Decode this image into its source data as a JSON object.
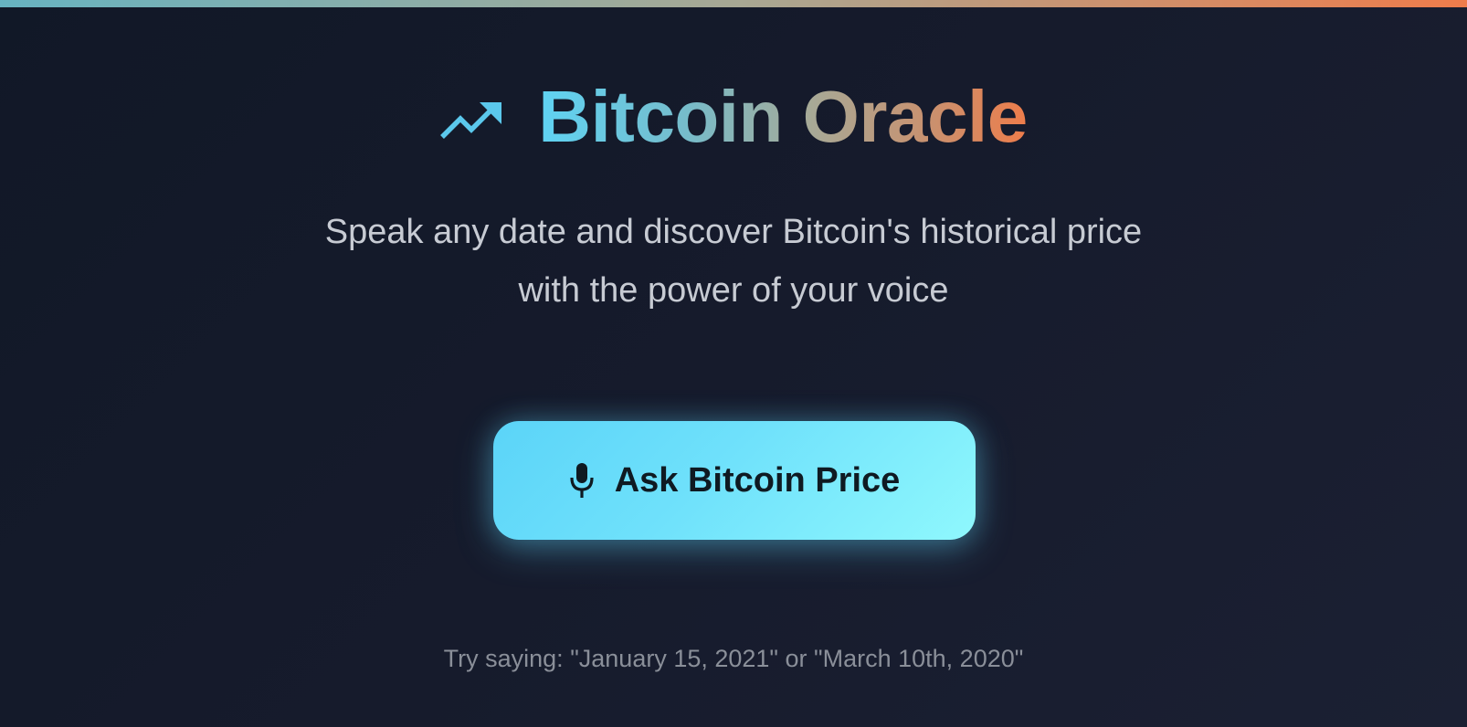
{
  "header": {
    "icon": "trending-up-icon",
    "title": "Bitcoin Oracle"
  },
  "subtitle": {
    "line1": "Speak any date and discover Bitcoin's historical price",
    "line2": "with the power of your voice"
  },
  "ask_button": {
    "icon": "microphone-icon",
    "label": "Ask Bitcoin Price"
  },
  "hint": {
    "text": "Try saying: \"January 15, 2021\" or \"March 10th, 2020\""
  },
  "colors": {
    "accent_start": "#5fd3f3",
    "accent_end": "#ee7d4b",
    "button_start": "#5bd4f8",
    "button_end": "#8ff8fd",
    "background": "#131a2a"
  }
}
